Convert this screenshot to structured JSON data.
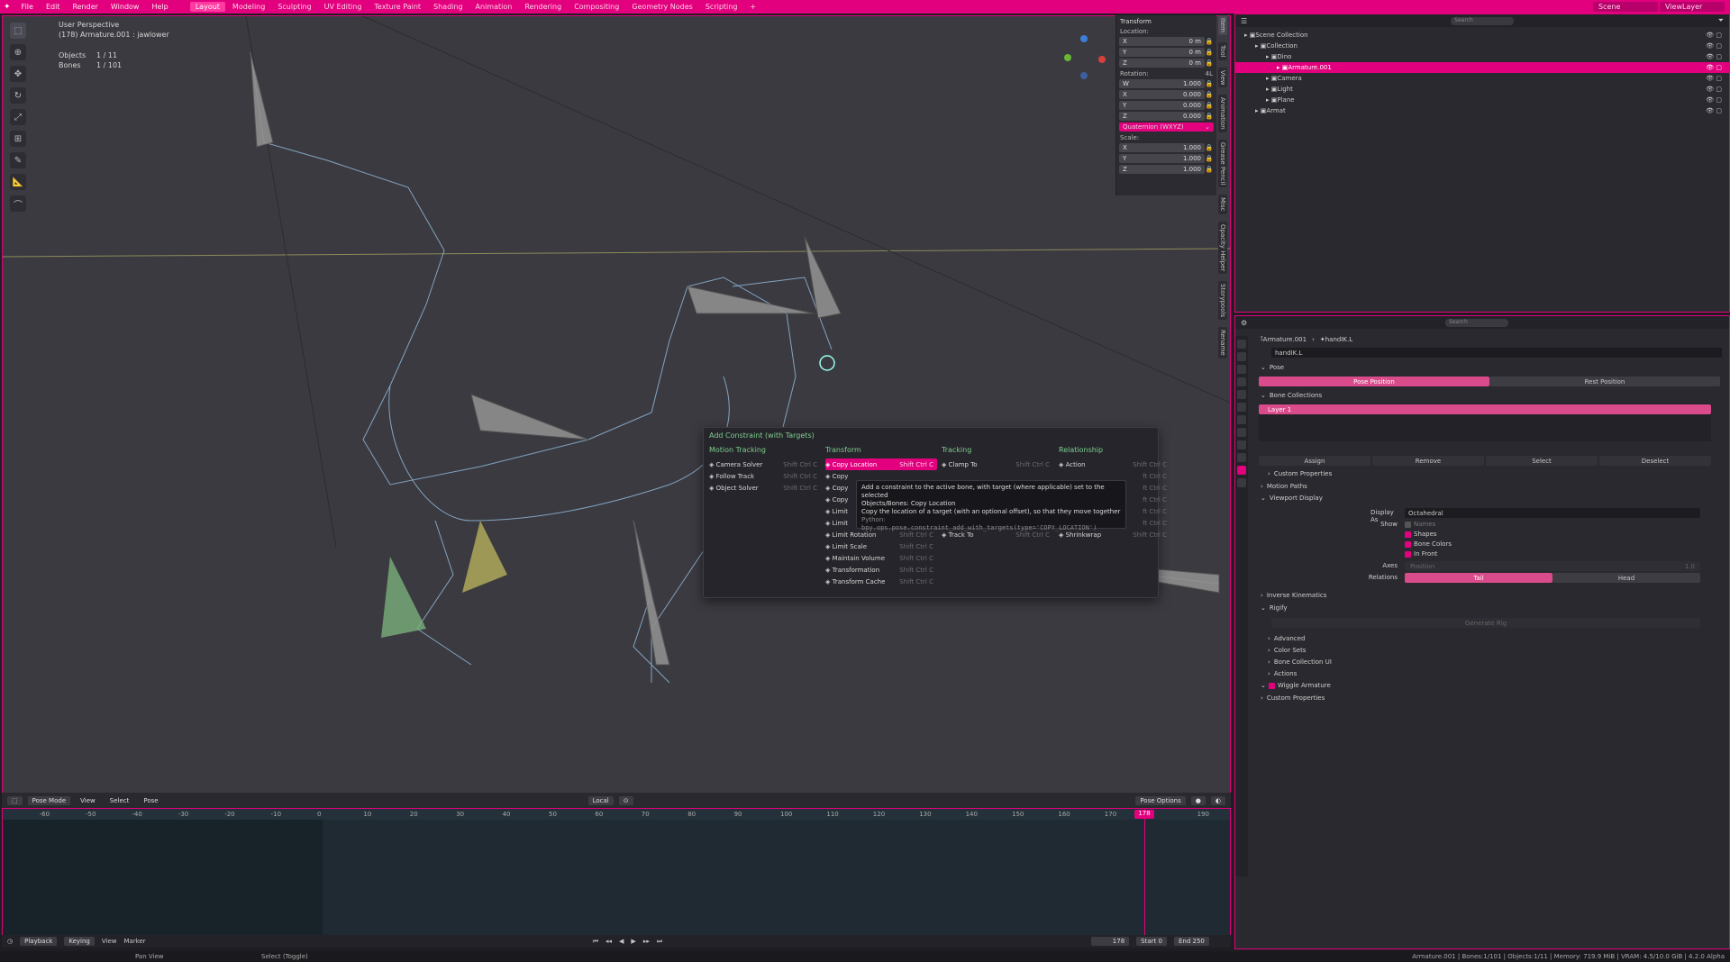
{
  "topbar": {
    "menus": [
      "File",
      "Edit",
      "Render",
      "Window",
      "Help"
    ],
    "workspaces": [
      "Layout",
      "Modeling",
      "Sculpting",
      "UV Editing",
      "Texture Paint",
      "Shading",
      "Animation",
      "Rendering",
      "Compositing",
      "Geometry Nodes",
      "Scripting"
    ],
    "scene_label": "Scene",
    "viewlayer_label": "ViewLayer"
  },
  "viewport": {
    "perspective": "User Perspective",
    "object_name": "(178) Armature.001 : jawlower",
    "objects_label": "Objects",
    "objects_value": "1 / 11",
    "bones_label": "Bones",
    "bones_value": "1 / 101"
  },
  "npanel": {
    "title": "Transform",
    "location_label": "Location:",
    "location": [
      {
        "axis": "X",
        "value": "0 m"
      },
      {
        "axis": "Y",
        "value": "0 m"
      },
      {
        "axis": "Z",
        "value": "0 m"
      }
    ],
    "rotation_label": "Rotation:",
    "rotation_mode_tag": "4L",
    "rotation": [
      {
        "axis": "W",
        "value": "1.000"
      },
      {
        "axis": "X",
        "value": "0.000"
      },
      {
        "axis": "Y",
        "value": "0.000"
      },
      {
        "axis": "Z",
        "value": "0.000"
      }
    ],
    "rotation_mode": "Quaternion (WXYZ)",
    "scale_label": "Scale:",
    "scale": [
      {
        "axis": "X",
        "value": "1.000"
      },
      {
        "axis": "Y",
        "value": "1.000"
      },
      {
        "axis": "Z",
        "value": "1.000"
      }
    ]
  },
  "sidetabs": [
    "Item",
    "Tool",
    "View",
    "Animation",
    "Grease Pencil",
    "Misc",
    "Opacity Helper",
    "Storypools",
    "Rename"
  ],
  "menu": {
    "title": "Add Constraint (with Targets)",
    "columns": [
      {
        "header": "Motion Tracking",
        "items": [
          {
            "label": "Camera Solver",
            "shortcut": "Shift Ctrl C"
          },
          {
            "label": "Follow Track",
            "shortcut": "Shift Ctrl C"
          },
          {
            "label": "Object Solver",
            "shortcut": "Shift Ctrl C"
          }
        ]
      },
      {
        "header": "Transform",
        "items": [
          {
            "label": "Copy Location",
            "shortcut": "Shift Ctrl C"
          },
          {
            "label": "Copy",
            "shortcut": ""
          },
          {
            "label": "Copy",
            "shortcut": ""
          },
          {
            "label": "Copy",
            "shortcut": ""
          },
          {
            "label": "Limit",
            "shortcut": ""
          },
          {
            "label": "Limit",
            "shortcut": ""
          },
          {
            "label": "Limit Rotation",
            "shortcut": "Shift Ctrl C"
          },
          {
            "label": "Limit Scale",
            "shortcut": "Shift Ctrl C"
          },
          {
            "label": "Maintain Volume",
            "shortcut": "Shift Ctrl C"
          },
          {
            "label": "Transformation",
            "shortcut": "Shift Ctrl C"
          },
          {
            "label": "Transform Cache",
            "shortcut": "Shift Ctrl C"
          }
        ]
      },
      {
        "header": "Tracking",
        "items": [
          {
            "label": "Clamp To",
            "shortcut": "Shift Ctrl C"
          },
          {
            "label": "",
            "shortcut": ""
          },
          {
            "label": "",
            "shortcut": ""
          },
          {
            "label": "",
            "shortcut": ""
          },
          {
            "label": "",
            "shortcut": ""
          },
          {
            "label": "",
            "shortcut": ""
          },
          {
            "label": "Track To",
            "shortcut": "Shift Ctrl C"
          }
        ]
      },
      {
        "header": "Relationship",
        "items": [
          {
            "label": "Action",
            "shortcut": "Shift Ctrl C"
          },
          {
            "label": "",
            "shortcut": "ft Ctrl C"
          },
          {
            "label": "",
            "shortcut": "ft Ctrl C"
          },
          {
            "label": "",
            "shortcut": "ft Ctrl C"
          },
          {
            "label": "",
            "shortcut": "ft Ctrl C"
          },
          {
            "label": "",
            "shortcut": "ft Ctrl C"
          },
          {
            "label": "Shrinkwrap",
            "shortcut": "Shift Ctrl C"
          }
        ]
      }
    ]
  },
  "tooltip": {
    "line1": "Add a constraint to the active bone, with target (where applicable) set to the selected",
    "line2": "Objects/Bones: Copy Location",
    "line3": "Copy the location of a target (with an optional offset), so that they move together",
    "line4": "Python:",
    "line5": "bpy.ops.pose.constraint_add_with_targets(type='COPY_LOCATION')"
  },
  "vpheader": {
    "mode": "Pose Mode",
    "menus": [
      "View",
      "Select",
      "Pose"
    ],
    "orientation": "Local",
    "pose_options": "Pose Options"
  },
  "timeline": {
    "ticks": [
      "-60",
      "-50",
      "-40",
      "-30",
      "-20",
      "-10",
      "0",
      "10",
      "20",
      "30",
      "40",
      "50",
      "60",
      "70",
      "80",
      "90",
      "100",
      "110",
      "120",
      "130",
      "140",
      "150",
      "160",
      "170",
      "178",
      "190"
    ],
    "current_frame": "178",
    "controls": {
      "playback": "Playback",
      "keying": "Keying",
      "view": "View",
      "marker": "Marker",
      "frame": "178",
      "start_label": "Start",
      "start": "0",
      "end_label": "End",
      "end": "250"
    }
  },
  "statusbar": {
    "left": "Pan View",
    "middle": "Select (Toggle)",
    "right": "Armature.001 | Bones:1/101 | Objects:1/11 | Memory: 719.9 MiB | VRAM: 4.5/10.0 GiB | 4.2.0 Alpha"
  },
  "outliner": {
    "search_placeholder": "Search",
    "rows": [
      {
        "label": "Scene Collection",
        "indent": 0
      },
      {
        "label": "Collection",
        "indent": 1
      },
      {
        "label": "Dino",
        "indent": 2
      },
      {
        "label": "Armature.001",
        "indent": 3,
        "selected": true
      },
      {
        "label": "Camera",
        "indent": 2
      },
      {
        "label": "Light",
        "indent": 2
      },
      {
        "label": "Plane",
        "indent": 2
      },
      {
        "label": "Armat",
        "indent": 1
      }
    ]
  },
  "props": {
    "search_placeholder": "Search",
    "breadcrumb_obj": "Armature.001",
    "breadcrumb_bone": "handIK.L",
    "bone_name": "handIK.L",
    "pose_label": "Pose",
    "pose_position": "Pose Position",
    "rest_position": "Rest Position",
    "bone_collections_label": "Bone Collections",
    "layer_name": "Layer 1",
    "assign": "Assign",
    "remove": "Remove",
    "select": "Select",
    "deselect": "Deselect",
    "custom_props_label": "Custom Properties",
    "motion_paths_label": "Motion Paths",
    "viewport_display_label": "Viewport Display",
    "display_as_label": "Display As",
    "display_as": "Octahedral",
    "show_label": "Show",
    "names": "Names",
    "shapes": "Shapes",
    "bone_colors": "Bone Colors",
    "in_front": "In Front",
    "axes_label": "Axes",
    "axes_position": "Position",
    "axes_value": "1.0",
    "relations_label": "Relations",
    "tail": "Tail",
    "head": "Head",
    "ik_label": "Inverse Kinematics",
    "rigify_label": "Rigify",
    "generate_rig": "Generate Rig",
    "advanced": "Advanced",
    "color_sets": "Color Sets",
    "bone_collection_ui": "Bone Collection UI",
    "actions": "Actions",
    "wiggle_label": "Wiggle Armature",
    "custom_props2": "Custom Properties"
  },
  "colors": {
    "accent": "#e3007e",
    "panel": "#2a292f",
    "viewport": "#3b3a40"
  }
}
